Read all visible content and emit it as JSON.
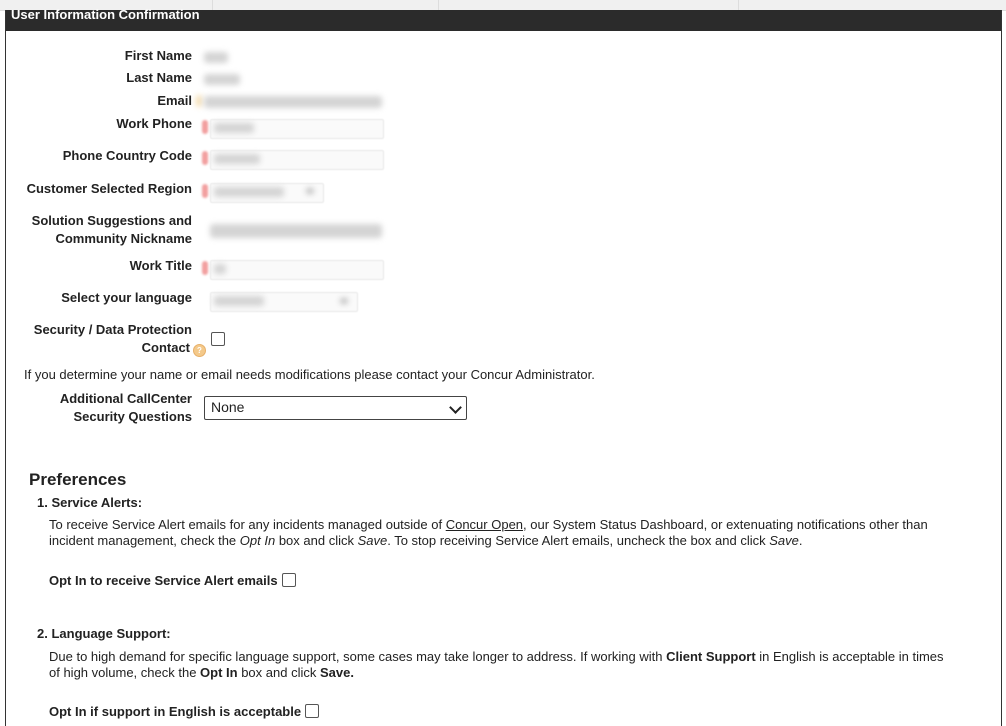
{
  "header": {
    "title": "User Information Confirmation"
  },
  "fields": {
    "first_name": "First Name",
    "last_name": "Last Name",
    "email": "Email",
    "work_phone": "Work Phone",
    "phone_country_code": "Phone Country Code",
    "customer_selected_region": "Customer Selected Region",
    "nickname_line1": "Solution Suggestions and",
    "nickname_line2": "Community Nickname",
    "work_title": "Work Title",
    "language": "Select your language",
    "security_line1": "Security / Data Protection",
    "security_line2": "Contact"
  },
  "note": "If you determine your name or email needs modifications please contact your Concur Administrator.",
  "callcenter": {
    "label_line1": "Additional CallCenter",
    "label_line2": "Security Questions",
    "selected": "None"
  },
  "preferences": {
    "title": "Preferences",
    "service_alerts": {
      "heading": "1. Service Alerts:",
      "text_1": "To receive Service Alert emails for any incidents managed outside of ",
      "link": "Concur Open",
      "text_2": ", our System Status Dashboard, or extenuating notifications other than incident management, check the ",
      "opt_in_em": "Opt In",
      "text_3": " box and click ",
      "save_em": "Save",
      "text_4": ". To stop receiving Service Alert emails, uncheck the box and click ",
      "save_em_2": "Save",
      "text_5": ".",
      "opt_label": "Opt In to receive Service Alert emails"
    },
    "language_support": {
      "heading": "2. Language Support:",
      "text_1": "Due to high demand for specific language support, some cases may take longer to address. If working with ",
      "client_support": "Client Support",
      "text_2": " in English is acceptable in times of high volume, check the ",
      "opt_in": "Opt In",
      "text_3": " box and click ",
      "save": "Save.",
      "opt_label": "Opt In if support in English is acceptable"
    }
  },
  "colors": {
    "header_bg": "#2b2b2b",
    "required_marker": "#f2a0a0"
  }
}
